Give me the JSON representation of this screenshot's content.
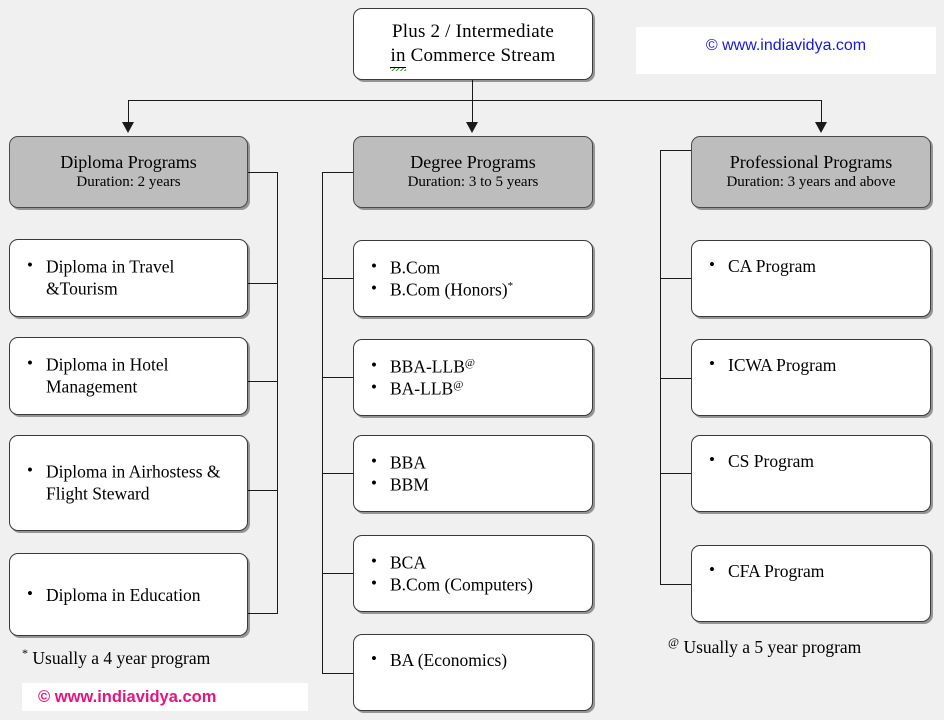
{
  "root": {
    "line1": "Plus 2 / Intermediate",
    "line2_prefix": "in",
    "line2_rest": " Commerce Stream"
  },
  "watermarks": {
    "top": "© www.indiavidya.com",
    "bottom": "© www.indiavidya.com"
  },
  "footnotes": {
    "left_mark": "*",
    "left_text": " Usually a 4 year program",
    "right_mark": "@",
    "right_text": " Usually a 5 year program"
  },
  "columns": [
    {
      "key": "diploma",
      "header_title": "Diploma Programs",
      "header_sub": "Duration: 2 years",
      "boxes": [
        {
          "items": [
            {
              "text": "Diploma in Travel &Tourism",
              "mark": ""
            }
          ]
        },
        {
          "items": [
            {
              "text": "Diploma in Hotel Management",
              "mark": ""
            }
          ]
        },
        {
          "items": [
            {
              "text": "Diploma in Airhostess & Flight Steward",
              "mark": ""
            }
          ]
        },
        {
          "items": [
            {
              "text": "Diploma in Education",
              "mark": ""
            }
          ]
        }
      ]
    },
    {
      "key": "degree",
      "header_title": "Degree Programs",
      "header_sub": "Duration: 3 to 5 years",
      "boxes": [
        {
          "items": [
            {
              "text": "B.Com",
              "mark": ""
            },
            {
              "text": "B.Com (Honors)",
              "mark": "*"
            }
          ]
        },
        {
          "items": [
            {
              "text": "BBA-LLB",
              "mark": "@"
            },
            {
              "text": "BA-LLB",
              "mark": "@"
            }
          ]
        },
        {
          "items": [
            {
              "text": "BBA",
              "mark": ""
            },
            {
              "text": "BBM",
              "mark": ""
            }
          ]
        },
        {
          "items": [
            {
              "text": "BCA",
              "mark": ""
            },
            {
              "text": "B.Com (Computers)",
              "mark": ""
            }
          ]
        },
        {
          "items": [
            {
              "text": "BA (Economics)",
              "mark": ""
            }
          ]
        }
      ]
    },
    {
      "key": "professional",
      "header_title": "Professional Programs",
      "header_sub": "Duration: 3 years and above",
      "boxes": [
        {
          "items": [
            {
              "text": "CA Program",
              "mark": ""
            }
          ]
        },
        {
          "items": [
            {
              "text": "ICWA Program",
              "mark": ""
            }
          ]
        },
        {
          "items": [
            {
              "text": "CS Program",
              "mark": ""
            }
          ]
        },
        {
          "items": [
            {
              "text": "CFA Program",
              "mark": ""
            }
          ]
        }
      ]
    }
  ],
  "colors": {
    "background": "#f0f0f0",
    "header_fill": "#bdbdbd",
    "box_fill": "#ffffff",
    "line": "#1a1a1a",
    "watermark_top": "#1818d8",
    "watermark_bottom": "#e3157f"
  }
}
